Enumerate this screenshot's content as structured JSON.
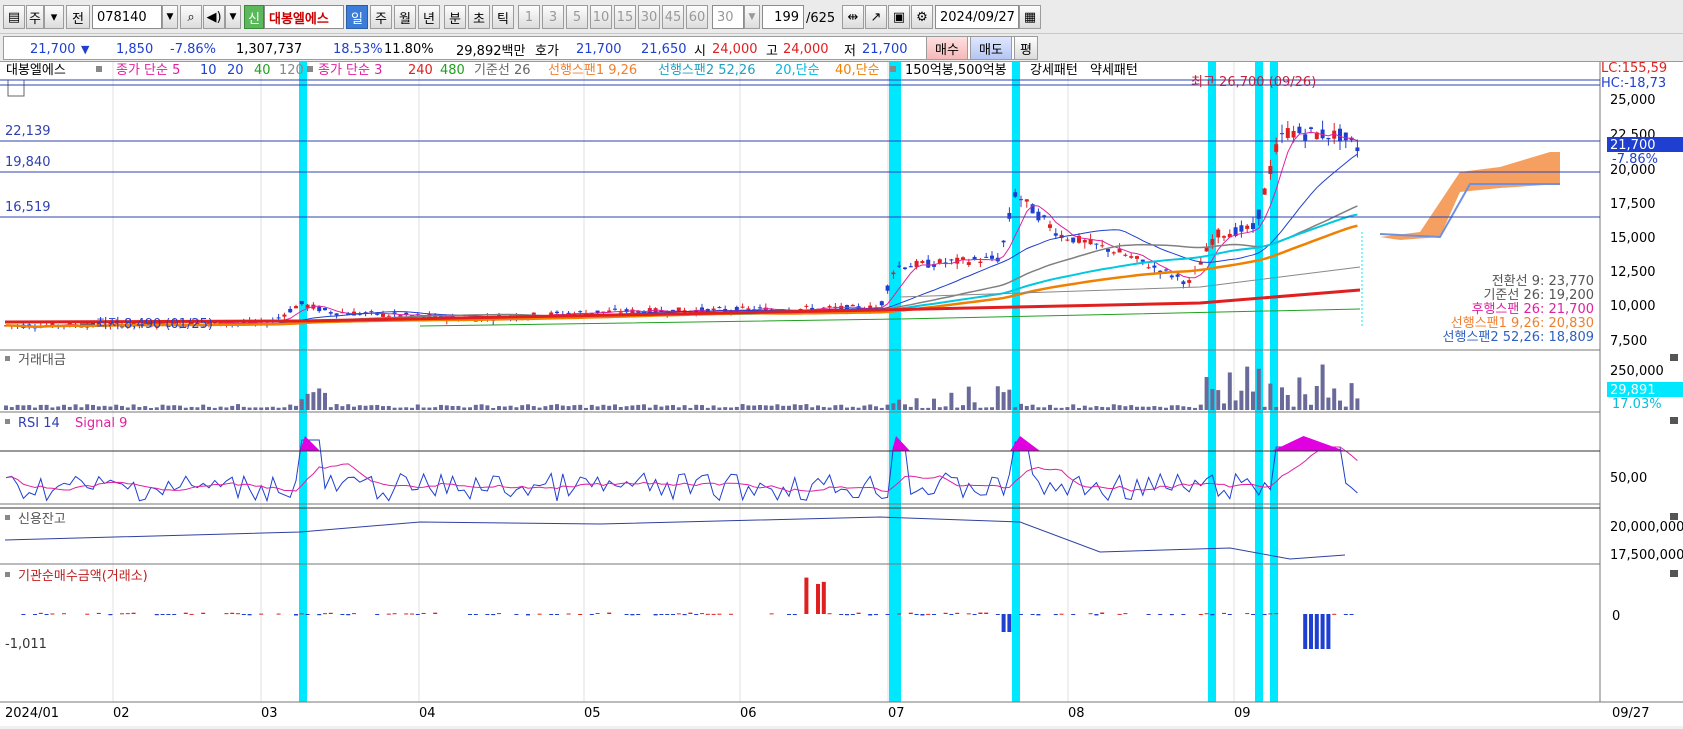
{
  "toolbar": {
    "type_label": "주",
    "compare_label": "전",
    "code": "078140",
    "credit_badge": "신",
    "stock_name": "대봉엘에스",
    "periods": [
      "일",
      "주",
      "월",
      "년",
      "분",
      "초",
      "틱"
    ],
    "active_period": "일",
    "intervals": [
      "1",
      "3",
      "5",
      "10",
      "15",
      "30",
      "45",
      "60"
    ],
    "interval_value": "30",
    "count_value": "199",
    "count_total": "/625",
    "date_value": "2024/09/27"
  },
  "quote": {
    "price": "21,700",
    "change": "1,850",
    "change_pct": "-7.86%",
    "volume": "1,307,737",
    "ratio1": "18.53%",
    "ratio2": "11.80%",
    "amount": "29,892백만",
    "ask_label": "호가",
    "ask": "21,700",
    "bid": "21,650",
    "open_label": "시",
    "open": "24,000",
    "high_label": "고",
    "high": "24,000",
    "low_label": "저",
    "low": "21,700",
    "buy_label": "매수",
    "sell_label": "매도",
    "avg_label": "평"
  },
  "legend": {
    "title": "대봉엘에스",
    "ma5": "종가 단순 5",
    "ma5_periods": [
      "10",
      "20",
      "40",
      "120"
    ],
    "ma3": "종가 단순 3",
    "ma3_periods": [
      "240",
      "480"
    ],
    "base": "기준선 26",
    "span1": "선행스팬1 9,26",
    "span2": "선행스팬2 52,26",
    "s20": "20,단순",
    "s40": "40,단순",
    "pattern": "150억봉,500억봉",
    "strong": "강세패턴",
    "weak": "약세패턴"
  },
  "price_panel": {
    "lc": "LC:155,59",
    "hc": "HC:-18,73",
    "high_note": "최고 26,700 (09/26)",
    "low_note": "최저 8,490 (01/25)",
    "h_lines": [
      "22,139",
      "19,840",
      "16,519"
    ],
    "current_price": "21,700",
    "current_pct": "-7.86%",
    "axis": [
      "25,000",
      "22,500",
      "20,000",
      "17,500",
      "15,000",
      "12,500",
      "10,000",
      "7,500"
    ],
    "ichimoku": [
      "전환선 9: 23,770",
      "기준선 26: 19,200",
      "후행스팬 26: 21,700",
      "선행스팬1 9,26: 20,830",
      "선행스팬2 52,26: 18,809"
    ]
  },
  "panels": {
    "amount_title": "거래대금",
    "amount_axis": "250,000",
    "amount_value": "29,891",
    "amount_pct": "17.03%",
    "rsi_title": "RSI 14",
    "rsi_signal": "Signal 9",
    "rsi_axis": "50,00",
    "credit_title": "신용잔고",
    "credit_axis": [
      "20,000,000",
      "17,500,000"
    ],
    "inst_title": "기관순매수금액(거래소)",
    "inst_axis": "0",
    "inst_min": "-1,011"
  },
  "x_axis": [
    "2024/01",
    "02",
    "03",
    "04",
    "05",
    "06",
    "07",
    "08",
    "09",
    "09/27"
  ],
  "colors": {
    "up": "#e02020",
    "down": "#1f3fd0",
    "highlight": "#00e8ff",
    "toolbar": "#ebebeb"
  }
}
